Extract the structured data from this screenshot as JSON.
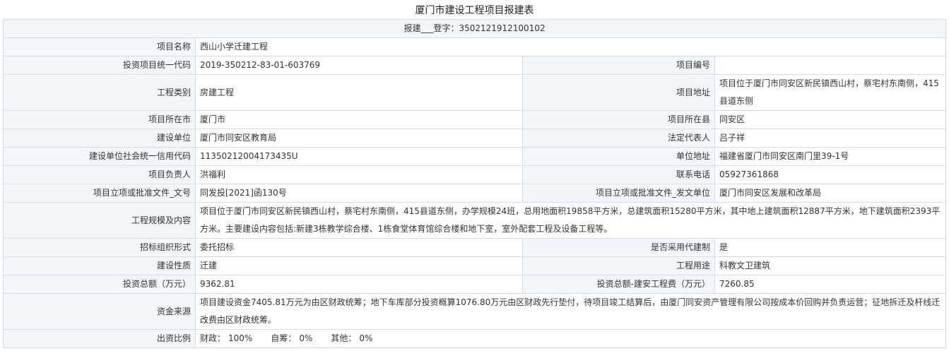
{
  "title": "厦门市建设工程项目报建表",
  "registration": "报建___登字：3502121912100102",
  "fields": {
    "project_name": {
      "label": "项目名称",
      "value": "西山小学迁建工程"
    },
    "unified_code": {
      "label": "投资项目统一代码",
      "value": "2019-350212-83-01-603769"
    },
    "project_no": {
      "label": "项目编号",
      "value": ""
    },
    "eng_category": {
      "label": "工程类别",
      "value": "房建工程"
    },
    "project_address": {
      "label": "项目地址",
      "value": "项目位于厦门市同安区新民镇西山村，蔡宅村东南侧，415县道东侧"
    },
    "city": {
      "label": "项目所在市",
      "value": "厦门市"
    },
    "county": {
      "label": "项目所在县",
      "value": "同安区"
    },
    "builder": {
      "label": "建设单位",
      "value": "厦门市同安区教育局"
    },
    "legal_rep": {
      "label": "法定代表人",
      "value": "吕子祥"
    },
    "credit_code": {
      "label": "建设单位社会统一信用代码",
      "value": "11350212004173435U"
    },
    "unit_address": {
      "label": "单位地址",
      "value": "福建省厦门市同安区南门里39-1号"
    },
    "manager": {
      "label": "项目负责人",
      "value": "洪福利"
    },
    "phone": {
      "label": "联系电话",
      "value": "05927361868"
    },
    "approval_doc_no": {
      "label": "项目立项或批准文件_文号",
      "value": "同发投[2021]函130号"
    },
    "approval_issuer": {
      "label": "项目立项或批准文件_发文单位",
      "value": "厦门市同安区发展和改革局"
    },
    "scale": {
      "label": "工程规模及内容",
      "value": "项目位于厦门市同安区新民镇西山村，蔡宅村东南侧，415县道东侧，办学规模24班，总用地面积19858平方米，总建筑面积15280平方米，其中地上建筑面积12887平方米，地下建筑面积2393平方米。主要建设内容包括:新建3栋教学综合楼、1栋食堂体育馆综合楼和地下室，室外配套工程及设备工程等。"
    },
    "bid_form": {
      "label": "招标组织形式",
      "value": "委托招标"
    },
    "agent_system": {
      "label": "是否采用代建制",
      "value": "是"
    },
    "nature": {
      "label": "建设性质",
      "value": "迁建"
    },
    "usage": {
      "label": "工程用途",
      "value": "科教文卫建筑"
    },
    "total_invest": {
      "label": "投资总额（万元）",
      "value": "9362.81"
    },
    "construction_cost": {
      "label": "投资总额-建安工程费（万元）",
      "value": "7260.85"
    },
    "fund_source": {
      "label": "资金来源",
      "value": "项目建设资金7405.81万元为由区财政统筹；地下车库部分投资概算1076.80万元由区财政先行垫付，待项目竣工结算后，由厦门同安资产管理有限公司按成本价回购并负责运营；征地拆迁及杆线迁改费由区财政统筹。"
    },
    "ratio": {
      "label": "出资比例",
      "fiscal_label": "财政：",
      "fiscal_value": "100%",
      "self_label": "自筹：",
      "self_value": "0%",
      "other_label": "其他：",
      "other_value": "0%"
    }
  }
}
